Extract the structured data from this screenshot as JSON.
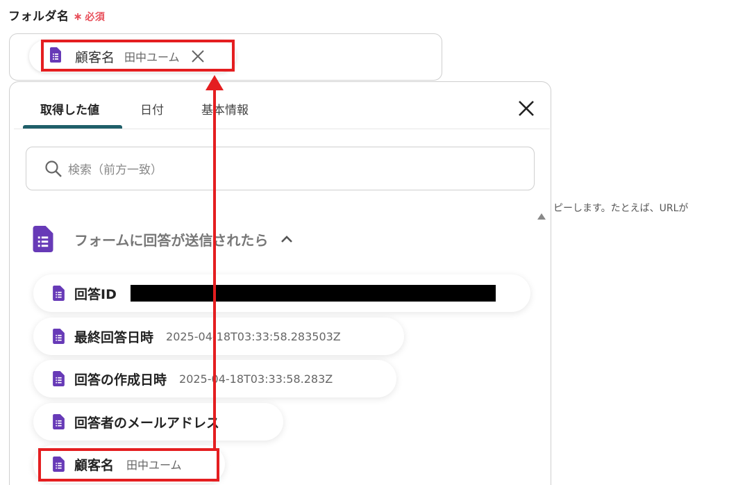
{
  "field": {
    "label": "フォルダ名",
    "required_mark": "∗",
    "required_text": "必須"
  },
  "selected_chip": {
    "name": "顧客名",
    "value": "田中ユーム",
    "icon": "google-forms-icon"
  },
  "tabs": [
    {
      "label": "取得した値",
      "active": true
    },
    {
      "label": "日付",
      "active": false
    },
    {
      "label": "基本情報",
      "active": false
    }
  ],
  "search": {
    "placeholder": "検索（前方一致）"
  },
  "section": {
    "title": "フォームに回答が送信されたら",
    "expanded": true
  },
  "items": [
    {
      "name": "回答ID",
      "value": "",
      "redacted": true
    },
    {
      "name": "最終回答日時",
      "value": "2025-04-18T03:33:58.283503Z"
    },
    {
      "name": "回答の作成日時",
      "value": "2025-04-18T03:33:58.283Z"
    },
    {
      "name": "回答者のメールアドレス",
      "value": ""
    },
    {
      "name": "顧客名",
      "value": "田中ユーム"
    }
  ],
  "side_text": "ピーします。たとえば、URLが",
  "colors": {
    "accent": "#1f5f69",
    "required": "#e8505b",
    "highlight": "#e41e20",
    "forms_purple": "#673ab7"
  }
}
